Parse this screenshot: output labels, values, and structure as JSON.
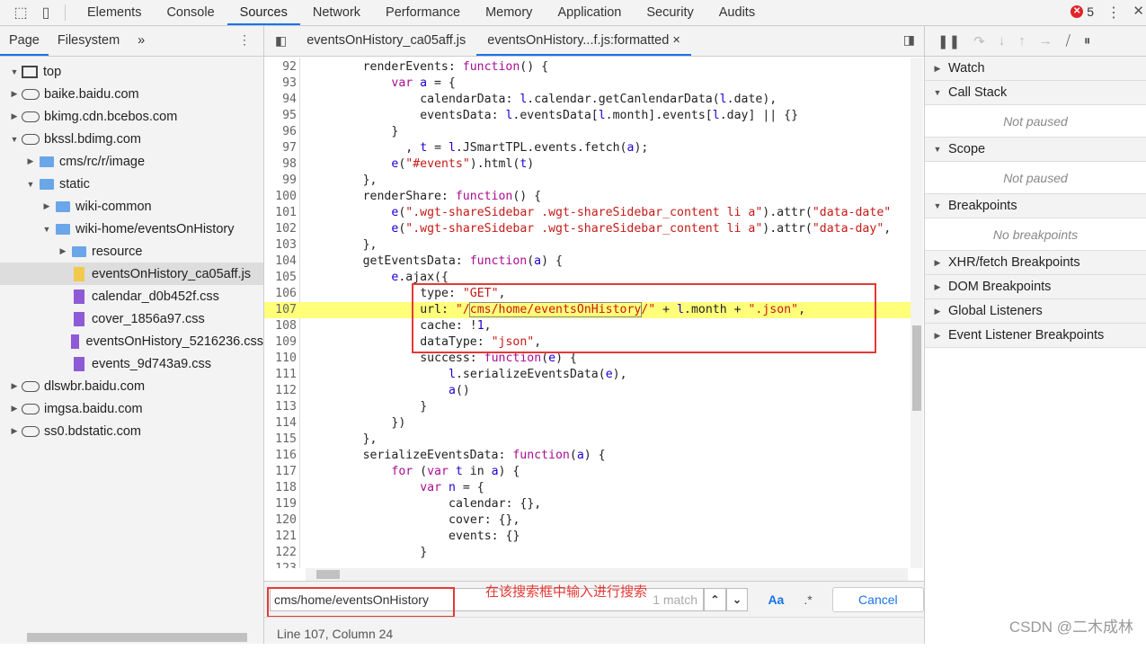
{
  "toolbar": {
    "tabs": [
      "Elements",
      "Console",
      "Sources",
      "Network",
      "Performance",
      "Memory",
      "Application",
      "Security",
      "Audits"
    ],
    "active": "Sources",
    "error_count": "5"
  },
  "navigator": {
    "tabs": [
      "Page",
      "Filesystem"
    ],
    "more": "»",
    "items": [
      {
        "label": "top",
        "type": "frame",
        "depth": 0,
        "open": true
      },
      {
        "label": "baike.baidu.com",
        "type": "cloud",
        "depth": 0,
        "open": false
      },
      {
        "label": "bkimg.cdn.bcebos.com",
        "type": "cloud",
        "depth": 0,
        "open": false
      },
      {
        "label": "bkssl.bdimg.com",
        "type": "cloud",
        "depth": 0,
        "open": true
      },
      {
        "label": "cms/rc/r/image",
        "type": "folder",
        "depth": 1,
        "open": false
      },
      {
        "label": "static",
        "type": "folder",
        "depth": 1,
        "open": true
      },
      {
        "label": "wiki-common",
        "type": "folder",
        "depth": 2,
        "open": false
      },
      {
        "label": "wiki-home/eventsOnHistory",
        "type": "folder",
        "depth": 2,
        "open": true
      },
      {
        "label": "resource",
        "type": "folder",
        "depth": 3,
        "open": false
      },
      {
        "label": "eventsOnHistory_ca05aff.js",
        "type": "js",
        "depth": 3,
        "selected": true
      },
      {
        "label": "calendar_d0b452f.css",
        "type": "css",
        "depth": 3
      },
      {
        "label": "cover_1856a97.css",
        "type": "css",
        "depth": 3
      },
      {
        "label": "eventsOnHistory_5216236.css",
        "type": "css",
        "depth": 3
      },
      {
        "label": "events_9d743a9.css",
        "type": "css",
        "depth": 3
      },
      {
        "label": "dlswbr.baidu.com",
        "type": "cloud",
        "depth": 0,
        "open": false
      },
      {
        "label": "imgsa.baidu.com",
        "type": "cloud",
        "depth": 0,
        "open": false
      },
      {
        "label": "ss0.bdstatic.com",
        "type": "cloud",
        "depth": 0,
        "open": false
      }
    ]
  },
  "editor": {
    "tabs": [
      "eventsOnHistory_ca05aff.js",
      "eventsOnHistory...f.js:formatted"
    ],
    "close": "×",
    "highlight_line": 107,
    "lines": [
      {
        "n": "92",
        "i": 8,
        "t": [
          [
            "",
            "renderEvents: "
          ],
          [
            "k",
            "function"
          ],
          [
            "",
            "() {"
          ]
        ]
      },
      {
        "n": "93",
        "i": 12,
        "t": [
          [
            "k",
            "var"
          ],
          [
            "v",
            " a"
          ],
          [
            "",
            " = {"
          ]
        ]
      },
      {
        "n": "94",
        "i": 16,
        "t": [
          [
            "",
            "calendarData: "
          ],
          [
            "v",
            "l"
          ],
          [
            "",
            ".calendar.getCanlendarData("
          ],
          [
            "v",
            "l"
          ],
          [
            "",
            ".date),"
          ]
        ]
      },
      {
        "n": "95",
        "i": 16,
        "t": [
          [
            "",
            "eventsData: "
          ],
          [
            "v",
            "l"
          ],
          [
            "",
            ".eventsData["
          ],
          [
            "v",
            "l"
          ],
          [
            "",
            ".month].events["
          ],
          [
            "v",
            "l"
          ],
          [
            "",
            ".day] || {}"
          ]
        ]
      },
      {
        "n": "96",
        "i": 12,
        "t": [
          [
            "",
            "}"
          ]
        ]
      },
      {
        "n": "97",
        "i": 14,
        "t": [
          [
            "",
            ", "
          ],
          [
            "v",
            "t"
          ],
          [
            "",
            " = "
          ],
          [
            "v",
            "l"
          ],
          [
            "",
            ".JSmartTPL.events.fetch("
          ],
          [
            "v",
            "a"
          ],
          [
            "",
            ");"
          ]
        ]
      },
      {
        "n": "98",
        "i": 12,
        "t": [
          [
            "v",
            "e"
          ],
          [
            "",
            "("
          ],
          [
            "s",
            "\"#events\""
          ],
          [
            "",
            ").html("
          ],
          [
            "v",
            "t"
          ],
          [
            "",
            ")"
          ]
        ]
      },
      {
        "n": "99",
        "i": 8,
        "t": [
          [
            "",
            "},"
          ]
        ]
      },
      {
        "n": "100",
        "i": 8,
        "t": [
          [
            "",
            "renderShare: "
          ],
          [
            "k",
            "function"
          ],
          [
            "",
            "() {"
          ]
        ]
      },
      {
        "n": "101",
        "i": 12,
        "t": [
          [
            "v",
            "e"
          ],
          [
            "",
            "("
          ],
          [
            "s",
            "\".wgt-shareSidebar .wgt-shareSidebar_content li a\""
          ],
          [
            "",
            ").attr("
          ],
          [
            "s",
            "\"data-date\""
          ]
        ]
      },
      {
        "n": "102",
        "i": 12,
        "t": [
          [
            "v",
            "e"
          ],
          [
            "",
            "("
          ],
          [
            "s",
            "\".wgt-shareSidebar .wgt-shareSidebar_content li a\""
          ],
          [
            "",
            ").attr("
          ],
          [
            "s",
            "\"data-day\""
          ],
          [
            "",
            ","
          ]
        ]
      },
      {
        "n": "103",
        "i": 8,
        "t": [
          [
            "",
            "},"
          ]
        ]
      },
      {
        "n": "104",
        "i": 8,
        "t": [
          [
            "",
            "getEventsData: "
          ],
          [
            "k",
            "function"
          ],
          [
            "",
            "("
          ],
          [
            "v",
            "a"
          ],
          [
            "",
            ") {"
          ]
        ]
      },
      {
        "n": "105",
        "i": 12,
        "t": [
          [
            "v",
            "e"
          ],
          [
            "",
            ".ajax({"
          ]
        ]
      },
      {
        "n": "106",
        "i": 16,
        "t": [
          [
            "",
            "type: "
          ],
          [
            "s",
            "\"GET\""
          ],
          [
            "",
            ","
          ]
        ]
      },
      {
        "n": "107",
        "i": 16,
        "t": [
          [
            "",
            "url: "
          ],
          [
            "s",
            "\"/"
          ],
          [
            "sm",
            "cms/home/eventsOnHistory"
          ],
          [
            "s",
            "/\""
          ],
          [
            "",
            " + "
          ],
          [
            "v",
            "l"
          ],
          [
            "",
            ".month + "
          ],
          [
            "s",
            "\".json\""
          ],
          [
            "",
            ","
          ]
        ]
      },
      {
        "n": "108",
        "i": 16,
        "t": [
          [
            "",
            "cache: !"
          ],
          [
            "v",
            "1"
          ],
          [
            "",
            ","
          ]
        ]
      },
      {
        "n": "109",
        "i": 16,
        "t": [
          [
            "",
            "dataType: "
          ],
          [
            "s",
            "\"json\""
          ],
          [
            "",
            ","
          ]
        ]
      },
      {
        "n": "110",
        "i": 16,
        "t": [
          [
            "",
            "success: "
          ],
          [
            "k",
            "function"
          ],
          [
            "",
            "("
          ],
          [
            "v",
            "e"
          ],
          [
            "",
            ") {"
          ]
        ]
      },
      {
        "n": "111",
        "i": 20,
        "t": [
          [
            "v",
            "l"
          ],
          [
            "",
            ".serializeEventsData("
          ],
          [
            "v",
            "e"
          ],
          [
            "",
            "),"
          ]
        ]
      },
      {
        "n": "112",
        "i": 20,
        "t": [
          [
            "v",
            "a"
          ],
          [
            "",
            "()"
          ]
        ]
      },
      {
        "n": "113",
        "i": 16,
        "t": [
          [
            "",
            "}"
          ]
        ]
      },
      {
        "n": "114",
        "i": 12,
        "t": [
          [
            "",
            "})"
          ]
        ]
      },
      {
        "n": "115",
        "i": 8,
        "t": [
          [
            "",
            "},"
          ]
        ]
      },
      {
        "n": "116",
        "i": 8,
        "t": [
          [
            "",
            "serializeEventsData: "
          ],
          [
            "k",
            "function"
          ],
          [
            "",
            "("
          ],
          [
            "v",
            "a"
          ],
          [
            "",
            ") {"
          ]
        ]
      },
      {
        "n": "117",
        "i": 12,
        "t": [
          [
            "k",
            "for"
          ],
          [
            "",
            " ("
          ],
          [
            "k",
            "var"
          ],
          [
            "v",
            " t"
          ],
          [
            "",
            " in "
          ],
          [
            "v",
            "a"
          ],
          [
            "",
            ") {"
          ]
        ]
      },
      {
        "n": "118",
        "i": 16,
        "t": [
          [
            "k",
            "var"
          ],
          [
            "v",
            " n"
          ],
          [
            "",
            " = {"
          ]
        ]
      },
      {
        "n": "119",
        "i": 20,
        "t": [
          [
            "",
            "calendar: {},"
          ]
        ]
      },
      {
        "n": "120",
        "i": 20,
        "t": [
          [
            "",
            "cover: {},"
          ]
        ]
      },
      {
        "n": "121",
        "i": 20,
        "t": [
          [
            "",
            "events: {}"
          ]
        ]
      },
      {
        "n": "122",
        "i": 16,
        "t": [
          [
            "",
            "}"
          ]
        ]
      },
      {
        "n": "123",
        "i": 16,
        "t": []
      }
    ]
  },
  "search": {
    "value": "cms/home/eventsOnHistory",
    "match": "1 match",
    "case_label": "Aa",
    "regex_label": ".*",
    "cancel": "Cancel",
    "annotation": "在该搜索框中输入进行搜索"
  },
  "status": "Line 107, Column 24",
  "debugger": {
    "sections": [
      {
        "label": "Watch",
        "open": false
      },
      {
        "label": "Call Stack",
        "open": true,
        "empty": "Not paused"
      },
      {
        "label": "Scope",
        "open": true,
        "empty": "Not paused"
      },
      {
        "label": "Breakpoints",
        "open": true,
        "empty": "No breakpoints"
      },
      {
        "label": "XHR/fetch Breakpoints",
        "open": false
      },
      {
        "label": "DOM Breakpoints",
        "open": false
      },
      {
        "label": "Global Listeners",
        "open": false
      },
      {
        "label": "Event Listener Breakpoints",
        "open": false
      }
    ]
  },
  "watermark": "CSDN @二木成林"
}
